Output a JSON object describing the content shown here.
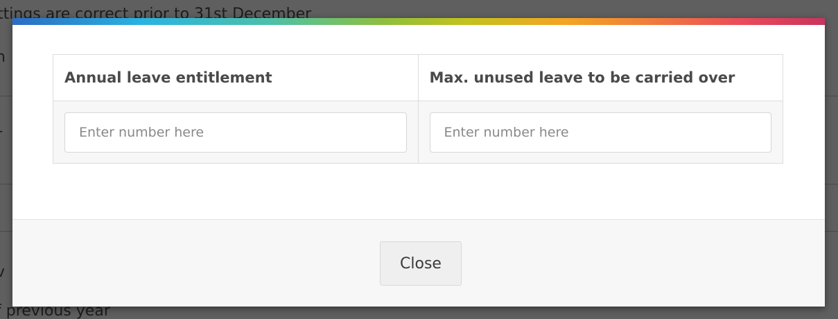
{
  "background": {
    "top_text": "ttings are correct prior to 31st December",
    "side_fragments": [
      "n",
      "r",
      "v"
    ],
    "bottom_text": "f previous year"
  },
  "modal": {
    "gradient_colors": [
      "#2b6cc4",
      "#2ab3e0",
      "#8fbf3a",
      "#f4a423",
      "#ea4a5a",
      "#c8345e"
    ],
    "table": {
      "headers": [
        "Annual leave entitlement",
        "Max. unused leave to be carried over"
      ],
      "inputs": [
        {
          "value": "",
          "placeholder": "Enter number here"
        },
        {
          "value": "",
          "placeholder": "Enter number here"
        }
      ]
    },
    "footer": {
      "close_label": "Close"
    }
  }
}
